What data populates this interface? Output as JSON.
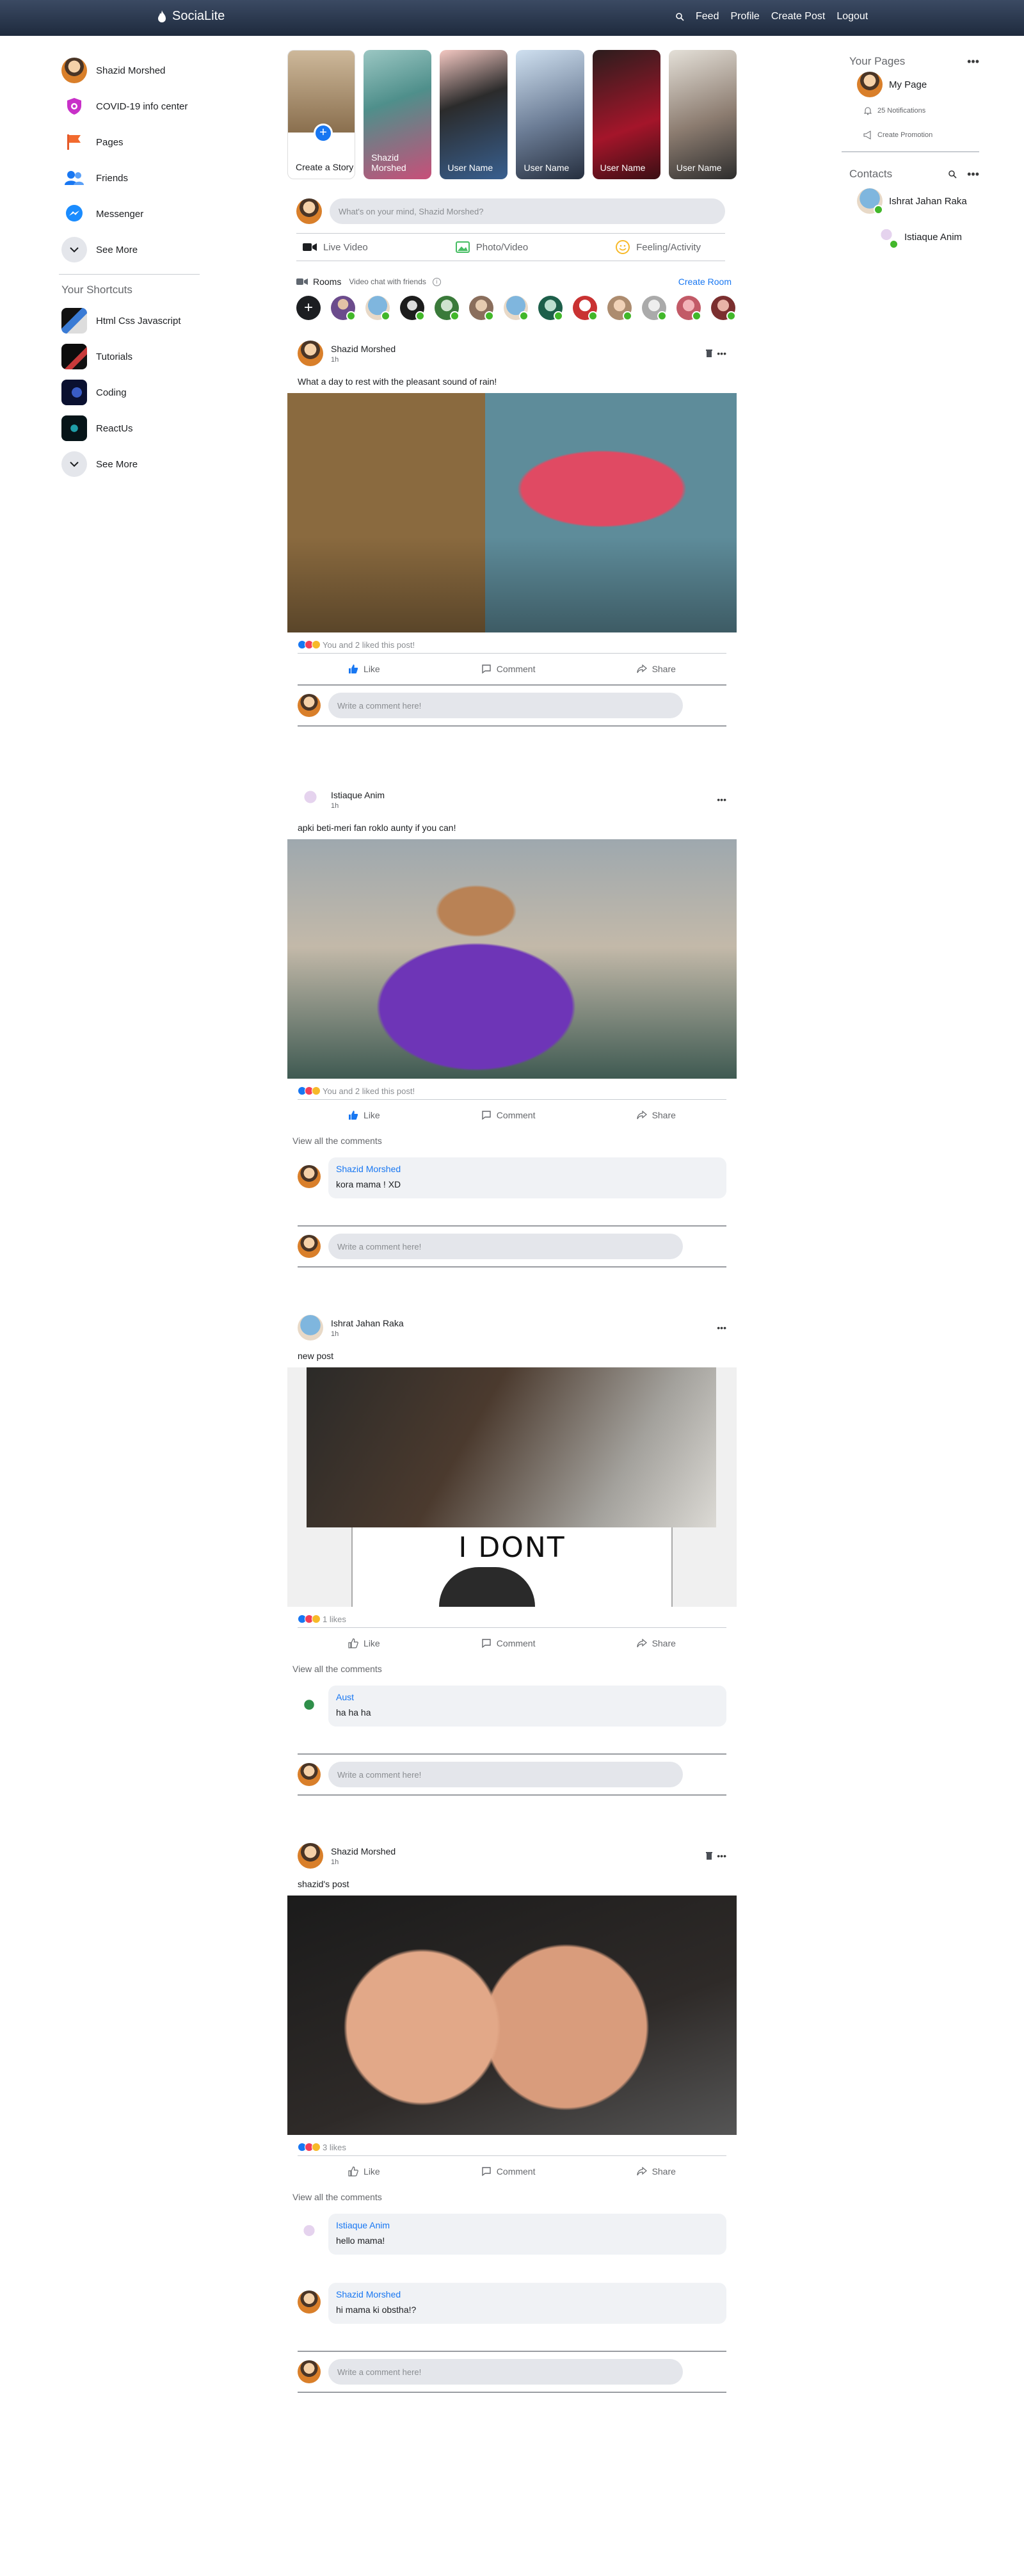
{
  "header": {
    "brand": "SociaLite",
    "nav": [
      "Feed",
      "Profile",
      "Create Post",
      "Logout"
    ]
  },
  "left_sidebar": {
    "items": [
      {
        "label": "Shazid Morshed",
        "icon": "avatar"
      },
      {
        "label": "COVID-19 info center",
        "icon": "covid-shield-icon"
      },
      {
        "label": "Pages",
        "icon": "flag-icon"
      },
      {
        "label": "Friends",
        "icon": "friends-icon"
      },
      {
        "label": "Messenger",
        "icon": "messenger-icon"
      },
      {
        "label": "See More",
        "icon": "chevron-down-icon"
      }
    ],
    "shortcuts_title": "Your Shortcuts",
    "shortcuts": [
      {
        "label": "Html Css Javascript"
      },
      {
        "label": "Tutorials"
      },
      {
        "label": "Coding"
      },
      {
        "label": "ReactUs"
      },
      {
        "label": "See More"
      }
    ]
  },
  "stories": {
    "create_label": "Create a Story",
    "items": [
      "Shazid Morshed",
      "User Name",
      "User Name",
      "User Name",
      "User Name"
    ]
  },
  "composer": {
    "placeholder": "What's on your mind, Shazid Morshed?",
    "actions": [
      "Live Video",
      "Photo/Video",
      "Feeling/Activity"
    ]
  },
  "rooms": {
    "title": "Rooms",
    "subtitle": "Video chat with friends",
    "create_link": "Create Room"
  },
  "posts": [
    {
      "author": "Shazid Morshed",
      "time": "1h",
      "text": "What a day to rest with the pleasant sound of rain!",
      "likes": "You and 2 liked this post!",
      "actions": [
        "Like",
        "Comment",
        "Share"
      ],
      "comment_placeholder": "Write a comment here!"
    },
    {
      "author": "Istiaque Anim",
      "time": "1h",
      "text": "apki beti-meri fan roklo aunty if you can!",
      "likes": "You and 2 liked this post!",
      "actions": [
        "Like",
        "Comment",
        "Share"
      ],
      "view_all": "View all the comments",
      "comments": [
        {
          "name": "Shazid Morshed",
          "text": "kora mama ! XD"
        }
      ],
      "comment_placeholder": "Write a comment here!"
    },
    {
      "author": "Ishrat Jahan Raka",
      "time": "1h",
      "text": "new post",
      "image_caption": "I DONT",
      "likes": "1 likes",
      "actions": [
        "Like",
        "Comment",
        "Share"
      ],
      "view_all": "View all the comments",
      "comments": [
        {
          "name": "Aust",
          "text": "ha ha ha"
        }
      ],
      "comment_placeholder": "Write a comment here!"
    },
    {
      "author": "Shazid Morshed",
      "time": "1h",
      "text": "shazid's post",
      "likes": "3 likes",
      "actions": [
        "Like",
        "Comment",
        "Share"
      ],
      "view_all": "View all the comments",
      "comments": [
        {
          "name": "Istiaque Anim",
          "text": "hello mama!"
        },
        {
          "name": "Shazid Morshed",
          "text": "hi mama ki obstha!?"
        }
      ],
      "comment_placeholder": "Write a comment here!"
    }
  ],
  "right_sidebar": {
    "pages_title": "Your Pages",
    "page_name": "My Page",
    "notifications": "25 Notifications",
    "promotion": "Create Promotion",
    "contacts_title": "Contacts",
    "contacts": [
      "Ishrat Jahan Raka",
      "Istiaque Anim"
    ]
  },
  "colors": {
    "header_top": "#3b4a63",
    "header_bottom": "#1e2a3d",
    "accent": "#1877f2",
    "online": "#42b72a"
  }
}
